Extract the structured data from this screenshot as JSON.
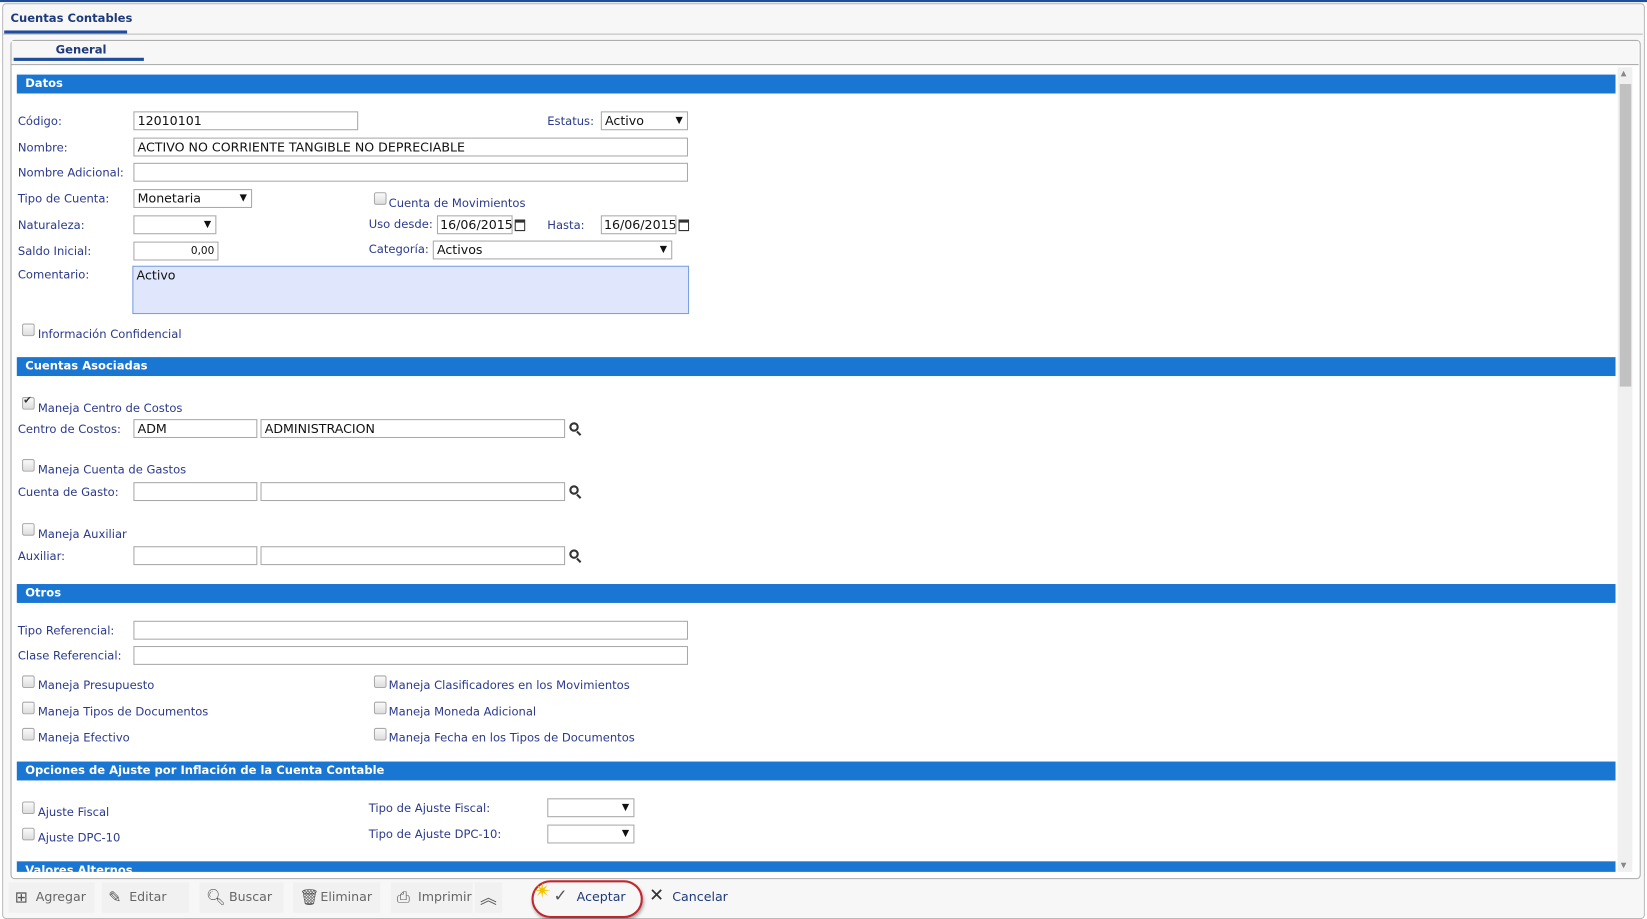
{
  "window": {
    "tab": "Cuentas Contables",
    "subtab": "General"
  },
  "sections": {
    "datos": "Datos",
    "cuentas": "Cuentas Asociadas",
    "otros": "Otros",
    "ajuste": "Opciones de Ajuste por Inflación de la Cuenta Contable",
    "valores": "Valores Alternos"
  },
  "datos": {
    "codigo_label": "Código:",
    "codigo": "12010101",
    "estatus_label": "Estatus:",
    "estatus": "Activo",
    "nombre_label": "Nombre:",
    "nombre": "ACTIVO NO CORRIENTE TANGIBLE NO DEPRECIABLE",
    "nombre_adicional_label": "Nombre Adicional:",
    "nombre_adicional": "",
    "tipo_label": "Tipo de Cuenta:",
    "tipo": "Monetaria",
    "movimientos_label": "Cuenta de Movimientos",
    "naturaleza_label": "Naturaleza:",
    "naturaleza": "",
    "uso_desde_label": "Uso desde:",
    "uso_desde": "16/06/2015",
    "hasta_label": "Hasta:",
    "hasta": "16/06/2015",
    "saldo_label": "Saldo Inicial:",
    "saldo": "0,00",
    "categoria_label": "Categoría:",
    "categoria": "Activos",
    "comentario_label": "Comentario:",
    "comentario": "Activo",
    "confidencial_label": "Información Confidencial"
  },
  "cuentas": {
    "centro_check": "Maneja Centro de Costos",
    "centro_label": "Centro de Costos:",
    "centro_code": "ADM",
    "centro_name": "ADMINISTRACION",
    "gastos_check": "Maneja Cuenta de Gastos",
    "gasto_label": "Cuenta de Gasto:",
    "aux_check": "Maneja Auxiliar",
    "aux_label": "Auxiliar:"
  },
  "otros": {
    "tipo_ref_label": "Tipo Referencial:",
    "clase_ref_label": "Clase Referencial:",
    "checks": [
      "Maneja Presupuesto",
      "Maneja Tipos de Documentos",
      "Maneja Efectivo",
      "Maneja Clasificadores en los Movimientos",
      "Maneja Moneda Adicional",
      "Maneja Fecha en los Tipos de Documentos"
    ]
  },
  "ajuste": {
    "fiscal": "Ajuste Fiscal",
    "dpc": "Ajuste DPC-10",
    "tipo_fiscal_label": "Tipo de Ajuste Fiscal:",
    "tipo_dpc_label": "Tipo de Ajuste DPC-10:"
  },
  "toolbar": {
    "agregar": "Agregar",
    "editar": "Editar",
    "buscar": "Buscar",
    "eliminar": "Eliminar",
    "imprimir": "Imprimir",
    "aceptar": "Aceptar",
    "cancelar": "Cancelar"
  }
}
